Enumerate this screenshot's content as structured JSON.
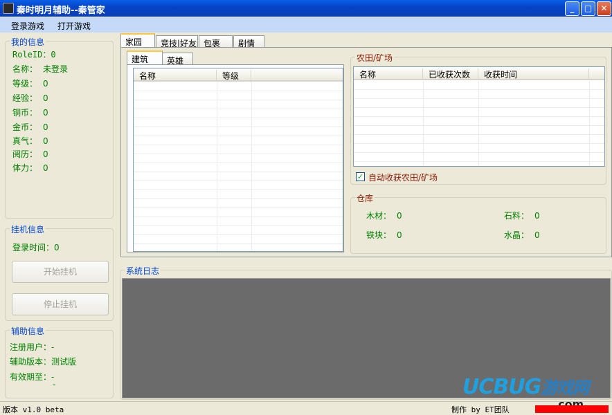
{
  "window": {
    "title": "秦时明月辅助--秦管家",
    "minimize": "_",
    "maximize": "□",
    "close": "✕"
  },
  "menu": [
    "登录游戏",
    "打开游戏"
  ],
  "myinfo": {
    "title": "我的信息",
    "fields": [
      {
        "label": "RoleID：",
        "value": "0"
      },
      {
        "label": "名称：",
        "value": "未登录"
      },
      {
        "label": "等级：",
        "value": "0"
      },
      {
        "label": "经验：",
        "value": "0"
      },
      {
        "label": "铜币：",
        "value": "0"
      },
      {
        "label": "金币：",
        "value": "0"
      },
      {
        "label": "真气：",
        "value": "0"
      },
      {
        "label": "阅历：",
        "value": "0"
      },
      {
        "label": "体力：",
        "value": "0"
      }
    ]
  },
  "hangup": {
    "title": "挂机信息",
    "login_time_label": "登录时间：",
    "login_time_value": "0",
    "start_button": "开始挂机",
    "stop_button": "停止挂机"
  },
  "assist": {
    "title": "辅助信息",
    "user_label": "注册用户：",
    "user_value": "-",
    "version_label": "辅助版本：",
    "version_value": "测试版",
    "expiry_label": "有效期至：",
    "expiry_value": "-",
    "expiry_extra": "-"
  },
  "main_tabs": [
    "家园",
    "竞技|好友",
    "包裹",
    "剧情"
  ],
  "sub_tabs": [
    "建筑",
    "英雄"
  ],
  "building_list": {
    "columns": [
      "名称",
      "等级"
    ]
  },
  "farm": {
    "title": "农田/矿场",
    "columns": [
      "名称",
      "已收获次数",
      "收获时间"
    ],
    "auto_checkbox": "自动收获农田/矿场",
    "checked": true,
    "check_mark": "✓"
  },
  "warehouse": {
    "title": "仓库",
    "items": [
      {
        "label": "木材：",
        "value": "0"
      },
      {
        "label": "石料：",
        "value": "0"
      },
      {
        "label": "铁块：",
        "value": "0"
      },
      {
        "label": "水晶：",
        "value": "0"
      }
    ]
  },
  "syslog": {
    "title": "系统日志"
  },
  "status": {
    "version": "版本 v1.0 beta",
    "maker": "制作 by ET团队"
  },
  "watermark": {
    "brand": "UCBUG",
    "cn": "游戏网",
    "dot_com": ".com"
  }
}
